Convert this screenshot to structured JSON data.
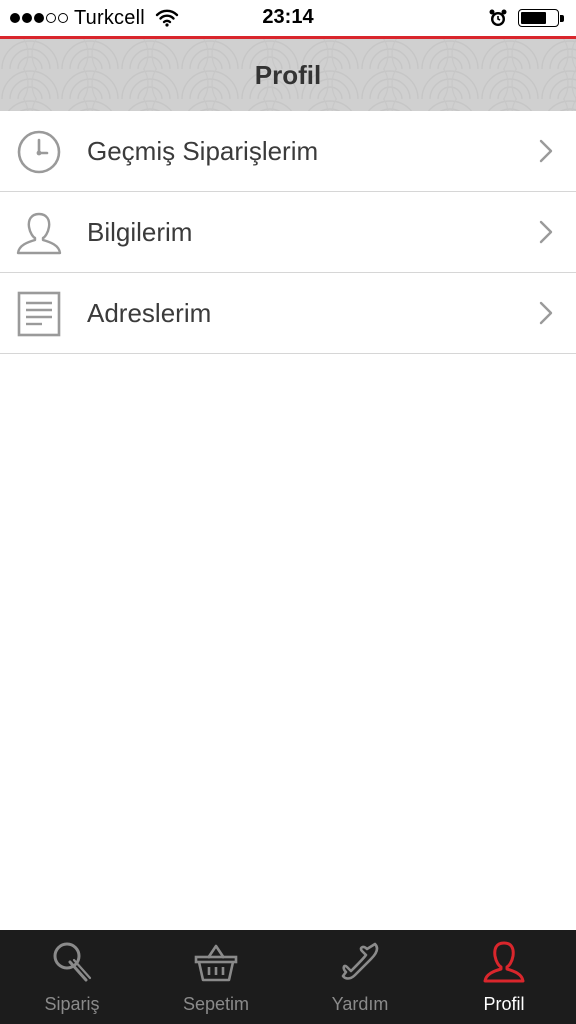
{
  "status_bar": {
    "carrier": "Turkcell",
    "time": "23:14",
    "signal_strength": 3,
    "signal_total": 5,
    "battery_level": 0.7
  },
  "nav": {
    "title": "Profil"
  },
  "menu": {
    "items": [
      {
        "label": "Geçmiş Siparişlerim",
        "icon": "clock-icon"
      },
      {
        "label": "Bilgilerim",
        "icon": "user-icon"
      },
      {
        "label": "Adreslerim",
        "icon": "document-icon"
      }
    ]
  },
  "tab_bar": {
    "tabs": [
      {
        "label": "Sipariş",
        "icon": "pizza-cutter-icon",
        "active": false
      },
      {
        "label": "Sepetim",
        "icon": "basket-icon",
        "active": false
      },
      {
        "label": "Yardım",
        "icon": "phone-icon",
        "active": false
      },
      {
        "label": "Profil",
        "icon": "user-icon",
        "active": true
      }
    ]
  },
  "colors": {
    "accent": "#d9262c",
    "nav_background": "#d0d0d0",
    "tab_bar_background": "#1c1c1c",
    "icon_gray": "#9a9a9a",
    "inactive_tab": "#8a8a8a"
  }
}
